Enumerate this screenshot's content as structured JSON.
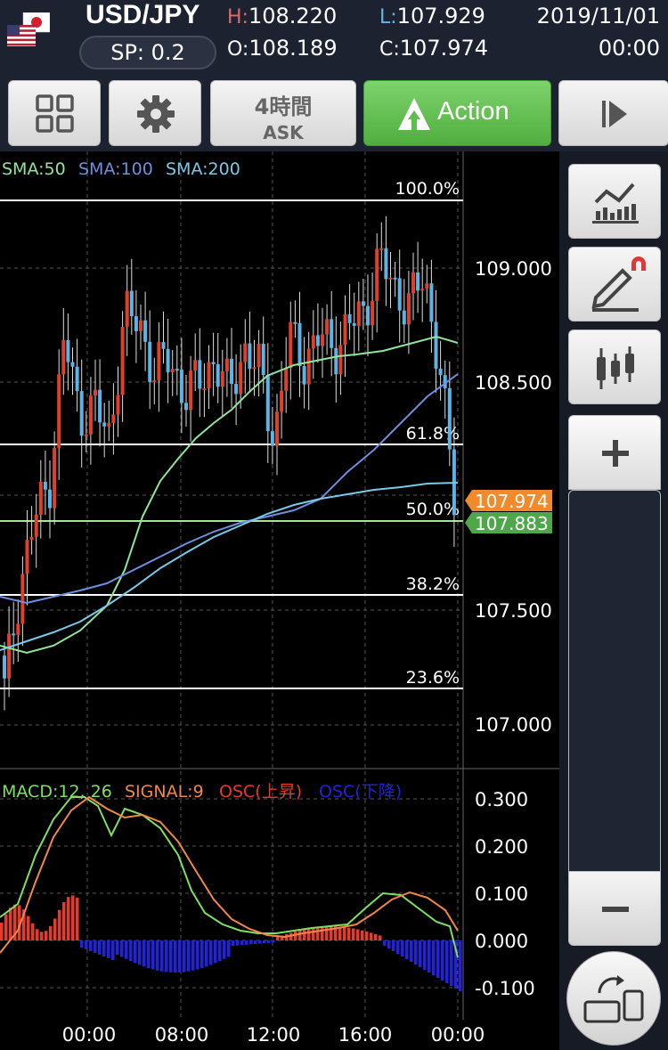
{
  "header": {
    "pair": "USD/JPY",
    "spread": "SP: 0.2",
    "high_key": "H:",
    "high": "108.220",
    "low_key": "L:",
    "low": "107.929",
    "open_key": "O:",
    "open": "108.189",
    "close_key": "C:",
    "close": "107.974",
    "date": "2019/11/01",
    "time": "00:00"
  },
  "toolbar": {
    "period": "4時間",
    "side": "ASK",
    "action": "Action"
  },
  "legend": {
    "sma50": "SMA:50",
    "sma100": "SMA:100",
    "sma200": "SMA:200"
  },
  "macd_legend": {
    "macd": "MACD:12, 26",
    "signal": "SIGNAL:9",
    "osc_up": "OSC(上昇)",
    "osc_down": "OSC(下降)"
  },
  "price_axis": [
    "109.000",
    "108.500",
    "107.500",
    "107.000"
  ],
  "macd_axis": [
    "0.300",
    "0.200",
    "0.100",
    "0.000",
    "-0.100"
  ],
  "time_axis": [
    "00:00",
    "08:00",
    "12:00",
    "16:00",
    "00:00"
  ],
  "fib_levels": [
    "100.0%",
    "61.8%",
    "50.0%",
    "38.2%",
    "23.6%"
  ],
  "price_tags": {
    "current": "107.974",
    "bid": "107.883"
  },
  "colors": {
    "up": "#e0402a",
    "down": "#5ab4e6",
    "sma50": "#8fe59a",
    "sma100": "#6e8fe0",
    "sma200": "#7cc8e8",
    "macd": "#7ee063",
    "signal": "#f0874a",
    "osc_up": "#e8392b",
    "osc_down": "#2222dd",
    "action": "#5cbf4b",
    "tag_orange": "#f08a2a",
    "tag_green": "#4ea84a"
  },
  "chart_data": [
    {
      "type": "candlestick",
      "ylim": [
        106.8,
        109.6
      ],
      "series": [
        {
          "name": "SMA:50"
        },
        {
          "name": "SMA:100"
        },
        {
          "name": "SMA:200"
        }
      ],
      "close": [
        107.15,
        107.6,
        107.9,
        108.05,
        108.7,
        108.35,
        108.4,
        108.25,
        108.8,
        108.75,
        108.55,
        108.6,
        108.45,
        108.5,
        108.6,
        108.45,
        108.65,
        108.55,
        108.25,
        108.7,
        108.6,
        108.7,
        108.65,
        108.75,
        108.8,
        109.05,
        108.9,
        108.85,
        108.95,
        108.6,
        107.974
      ],
      "fibonacci": [
        {
          "level": "100.0%",
          "price": 109.3
        },
        {
          "level": "61.8%",
          "price": 108.28
        },
        {
          "level": "50.0%",
          "price": 107.95
        },
        {
          "level": "38.2%",
          "price": 107.65
        },
        {
          "level": "23.6%",
          "price": 107.24
        }
      ],
      "current_price": 107.974,
      "bid_price": 107.883
    },
    {
      "type": "line",
      "title": "MACD",
      "ylim": [
        -0.15,
        0.35
      ],
      "series": [
        {
          "name": "MACD:12, 26",
          "values": [
            0.05,
            0.2,
            0.3,
            0.25,
            0.27,
            0.27,
            0.15,
            0.05,
            0.02,
            0.01,
            0.04,
            0.07,
            0.11,
            0.09,
            0.05,
            -0.03
          ]
        },
        {
          "name": "SIGNAL:9",
          "values": [
            -0.01,
            0.15,
            0.28,
            0.28,
            0.26,
            0.25,
            0.18,
            0.08,
            0.03,
            0.01,
            0.02,
            0.04,
            0.07,
            0.09,
            0.07,
            0.02
          ]
        }
      ]
    }
  ]
}
